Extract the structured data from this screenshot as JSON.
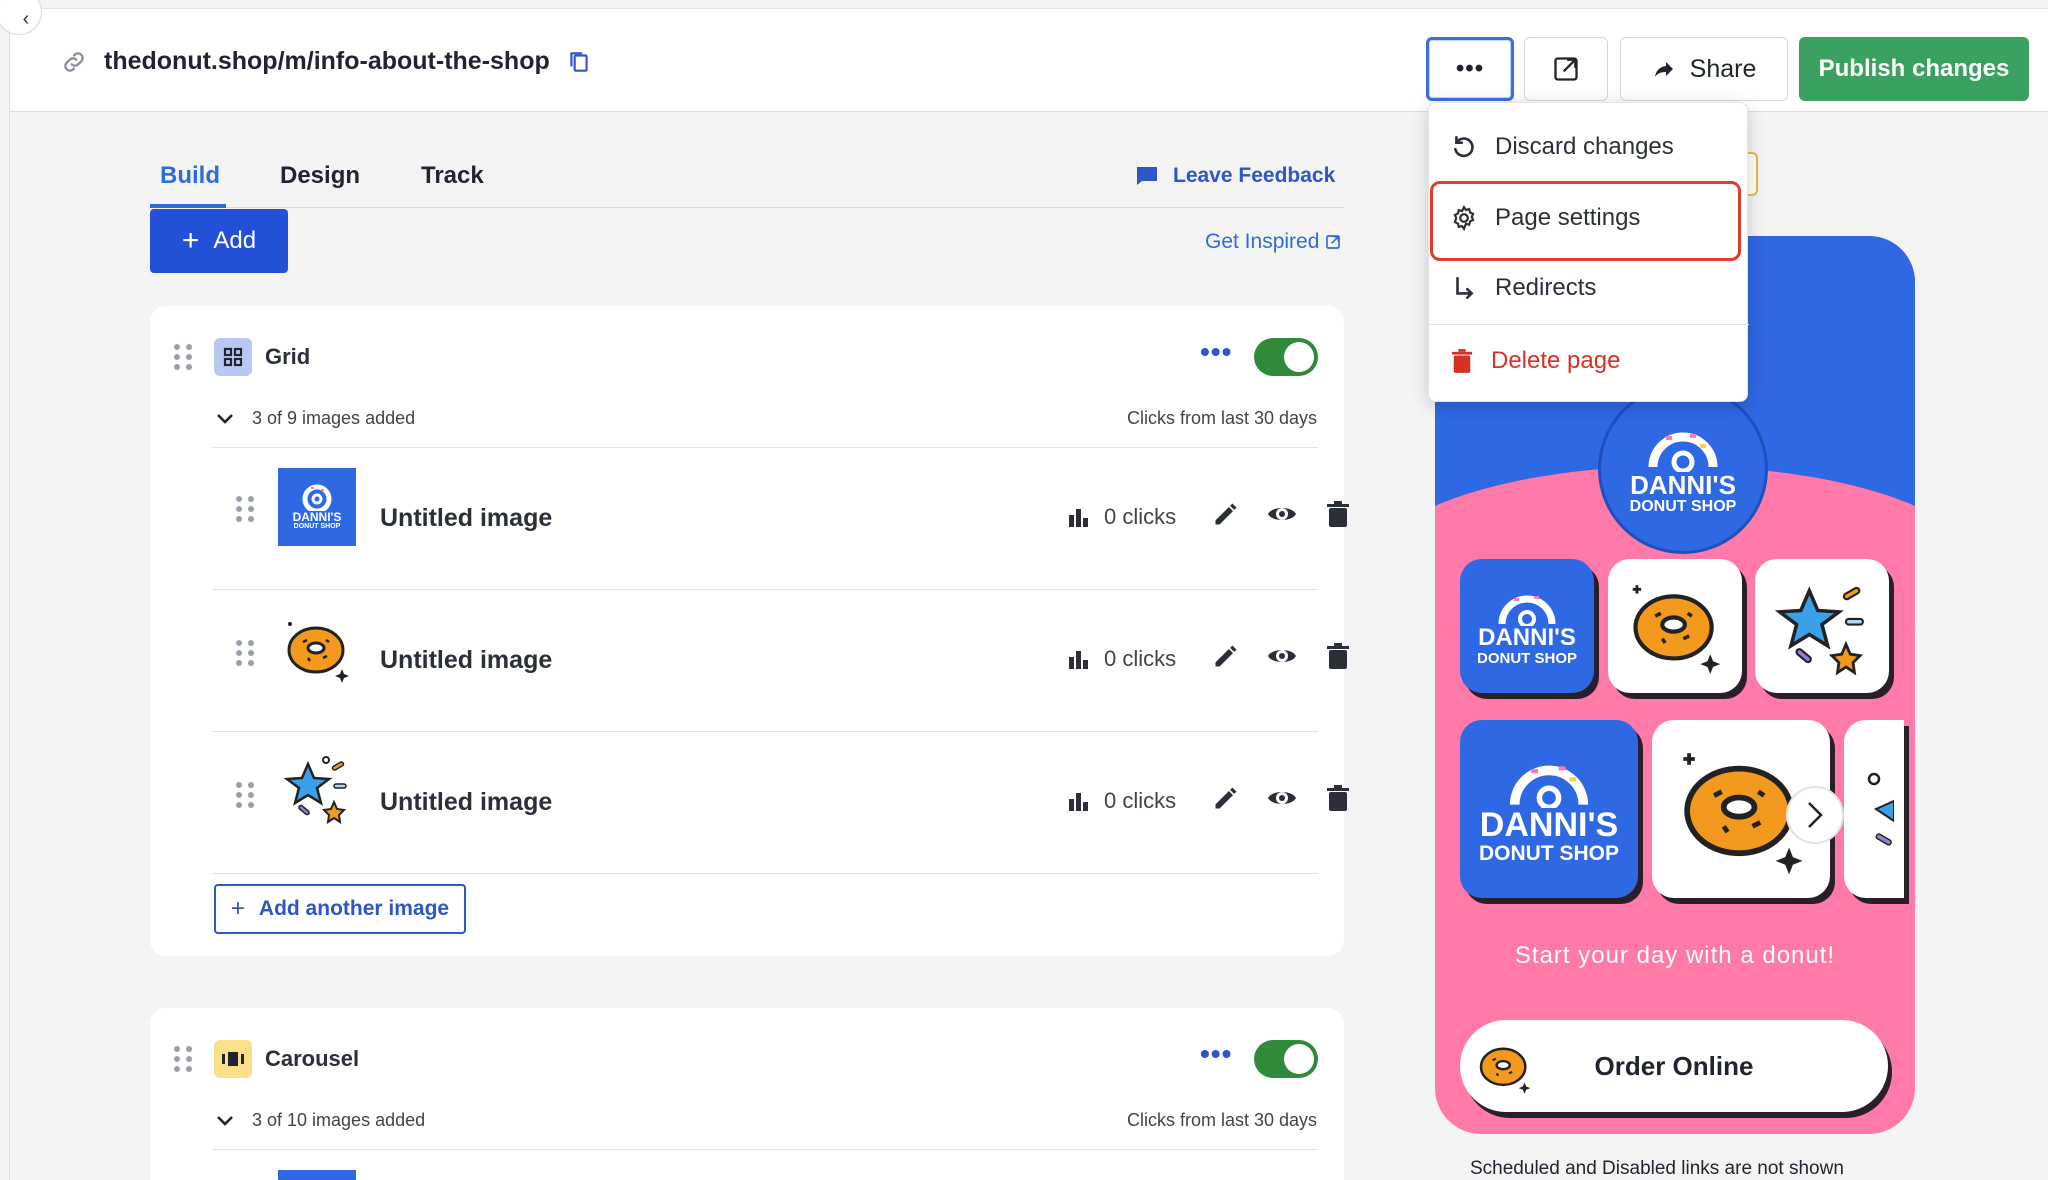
{
  "topbar": {
    "url": "thedonut.shop/m/info-about-the-shop",
    "share_label": "Share",
    "publish_label": "Publish changes"
  },
  "tabs": [
    {
      "label": "Build",
      "active": true
    },
    {
      "label": "Design",
      "active": false
    },
    {
      "label": "Track",
      "active": false
    }
  ],
  "feedback_label": "Leave Feedback",
  "add_label": "Add",
  "get_inspired_label": "Get Inspired",
  "grid_block": {
    "title": "Grid",
    "summary": "3 of 9 images added",
    "clicks_caption": "Clicks from last 30 days",
    "enabled": true,
    "items": [
      {
        "title": "Untitled image",
        "clicks": "0 clicks",
        "thumb": "dannis-logo"
      },
      {
        "title": "Untitled image",
        "clicks": "0 clicks",
        "thumb": "donut"
      },
      {
        "title": "Untitled image",
        "clicks": "0 clicks",
        "thumb": "stars"
      }
    ],
    "add_another_label": "Add another image"
  },
  "carousel_block": {
    "title": "Carousel",
    "summary": "3 of 10 images added",
    "clicks_caption": "Clicks from last 30 days",
    "enabled": true
  },
  "menu": {
    "items": [
      {
        "label": "Discard changes",
        "icon": "undo-icon"
      },
      {
        "label": "Page settings",
        "icon": "gear-icon"
      },
      {
        "label": "Redirects",
        "icon": "redirect-arrow-icon"
      },
      {
        "label": "Delete page",
        "icon": "trash-icon"
      }
    ]
  },
  "preview": {
    "logo_line1": "DANNI'S",
    "logo_line2": "DONUT SHOP",
    "tagline": "Start your day with a donut!",
    "order_label": "Order Online",
    "note": "Scheduled and Disabled links are not shown"
  },
  "colors": {
    "accent_blue": "#2450d8",
    "publish_green": "#3aa160",
    "toggle_green": "#2f8a3a",
    "phone_pink": "#ff79a9",
    "phone_blue": "#2f68e3",
    "danger_red": "#d93025"
  }
}
